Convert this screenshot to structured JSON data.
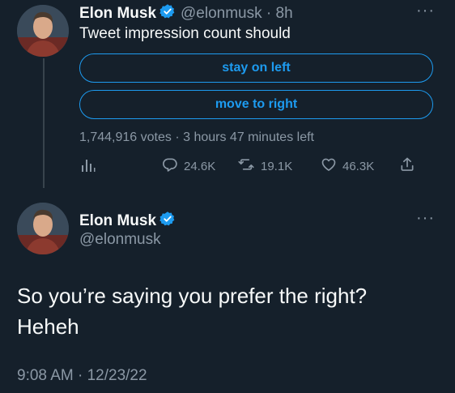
{
  "first_tweet": {
    "name": "Elon Musk",
    "handle": "@elonmusk",
    "separator": "·",
    "time": "8h",
    "text": "Tweet impression count should",
    "more": "···",
    "poll": {
      "options": [
        "stay on left",
        "move to right"
      ],
      "votes": "1,744,916 votes",
      "dot": "·",
      "time_left": "3 hours 47 minutes left"
    },
    "actions": {
      "replies": "24.6K",
      "retweets": "19.1K",
      "likes": "46.3K"
    }
  },
  "reply_tweet": {
    "name": "Elon Musk",
    "handle": "@elonmusk",
    "more": "···",
    "text_line1": "So you’re saying you prefer the right?",
    "text_line2": "Heheh",
    "timestamp": "9:08 AM · 12/23/22"
  },
  "colors": {
    "background": "#15202b",
    "accent": "#1d9bf0",
    "muted": "#8b98a5",
    "verified": "#1d9bf0"
  },
  "icons": [
    "verified-badge-icon",
    "analytics-icon",
    "reply-icon",
    "retweet-icon",
    "like-icon",
    "share-icon"
  ]
}
